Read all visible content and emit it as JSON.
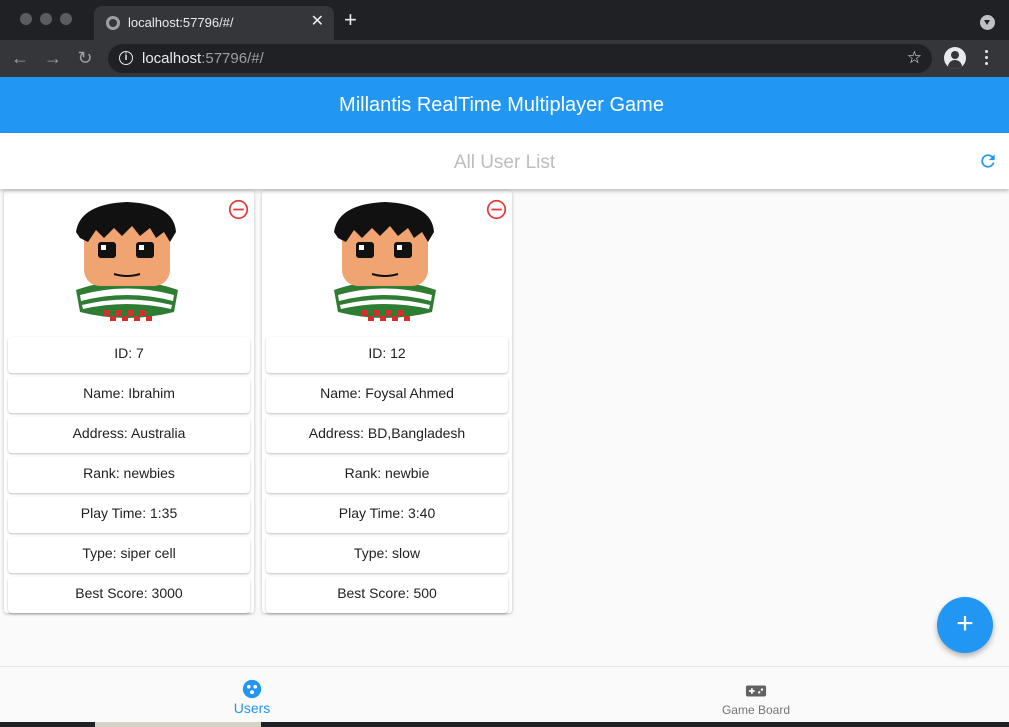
{
  "browser": {
    "tab_title": "localhost:57796/#/",
    "tab_close": "✕",
    "new_tab": "+",
    "url_host": "localhost",
    "url_rest": ":57796/#/",
    "nav_back": "←",
    "nav_forward": "→",
    "nav_reload": "↻",
    "star": "☆"
  },
  "app": {
    "title": "Millantis RealTime Multiplayer Game",
    "list_title": "All User List",
    "accent_color": "#2196f3",
    "remove_color": "#e53935",
    "fab_label": "+"
  },
  "users": [
    {
      "id": "ID: 7",
      "name": "Name: Ibrahim",
      "address": "Address: Australia",
      "rank": "Rank: newbies",
      "play_time": "Play Time: 1:35",
      "type": "Type: siper cell",
      "best_score": "Best Score: 3000"
    },
    {
      "id": "ID: 12",
      "name": "Name: Foysal Ahmed",
      "address": "Address: BD,Bangladesh",
      "rank": "Rank: newbie",
      "play_time": "Play Time: 3:40",
      "type": "Type: slow",
      "best_score": "Best Score: 500"
    }
  ],
  "bottom_nav": {
    "items": [
      {
        "label": "Users",
        "icon": "users-icon",
        "active": true
      },
      {
        "label": "Game Board",
        "icon": "gamepad-icon",
        "active": false
      }
    ]
  }
}
